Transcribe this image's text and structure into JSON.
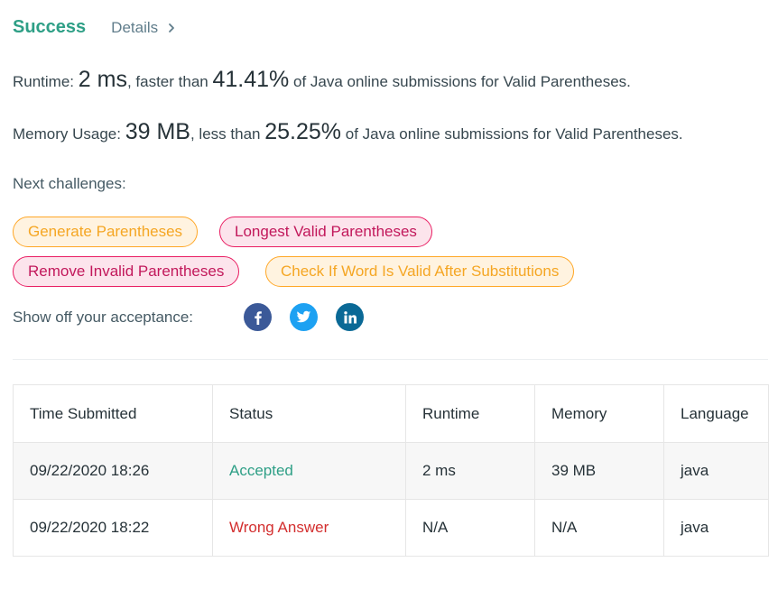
{
  "header": {
    "status": "Success",
    "details_label": "Details"
  },
  "runtime": {
    "label": "Runtime:",
    "value": "2 ms",
    "comp": ", faster than",
    "percent": "41.41%",
    "suffix": "of Java online submissions for Valid Parentheses."
  },
  "memory": {
    "label": "Memory Usage:",
    "value": "39 MB",
    "comp": ", less than",
    "percent": "25.25%",
    "suffix": "of Java online submissions for Valid Parentheses."
  },
  "next": {
    "label": "Next challenges:",
    "chips": [
      {
        "label": "Generate Parentheses",
        "style": "orange"
      },
      {
        "label": "Longest Valid Parentheses",
        "style": "pink"
      },
      {
        "label": "Remove Invalid Parentheses",
        "style": "pink"
      },
      {
        "label": "Check If Word Is Valid After Substitutions",
        "style": "orange"
      }
    ]
  },
  "share": {
    "label": "Show off your acceptance:",
    "icons": [
      "facebook-icon",
      "twitter-icon",
      "linkedin-icon"
    ]
  },
  "colors": {
    "success": "#2e9f86",
    "wrong": "#d32f2f",
    "facebook": "#3b5998",
    "twitter": "#1da1f2",
    "linkedin": "#0077b5"
  },
  "table": {
    "headers": [
      "Time Submitted",
      "Status",
      "Runtime",
      "Memory",
      "Language"
    ],
    "rows": [
      {
        "time": "09/22/2020 18:26",
        "status": "Accepted",
        "runtime": "2 ms",
        "memory": "39 MB",
        "language": "java"
      },
      {
        "time": "09/22/2020 18:22",
        "status": "Wrong Answer",
        "runtime": "N/A",
        "memory": "N/A",
        "language": "java"
      }
    ]
  }
}
